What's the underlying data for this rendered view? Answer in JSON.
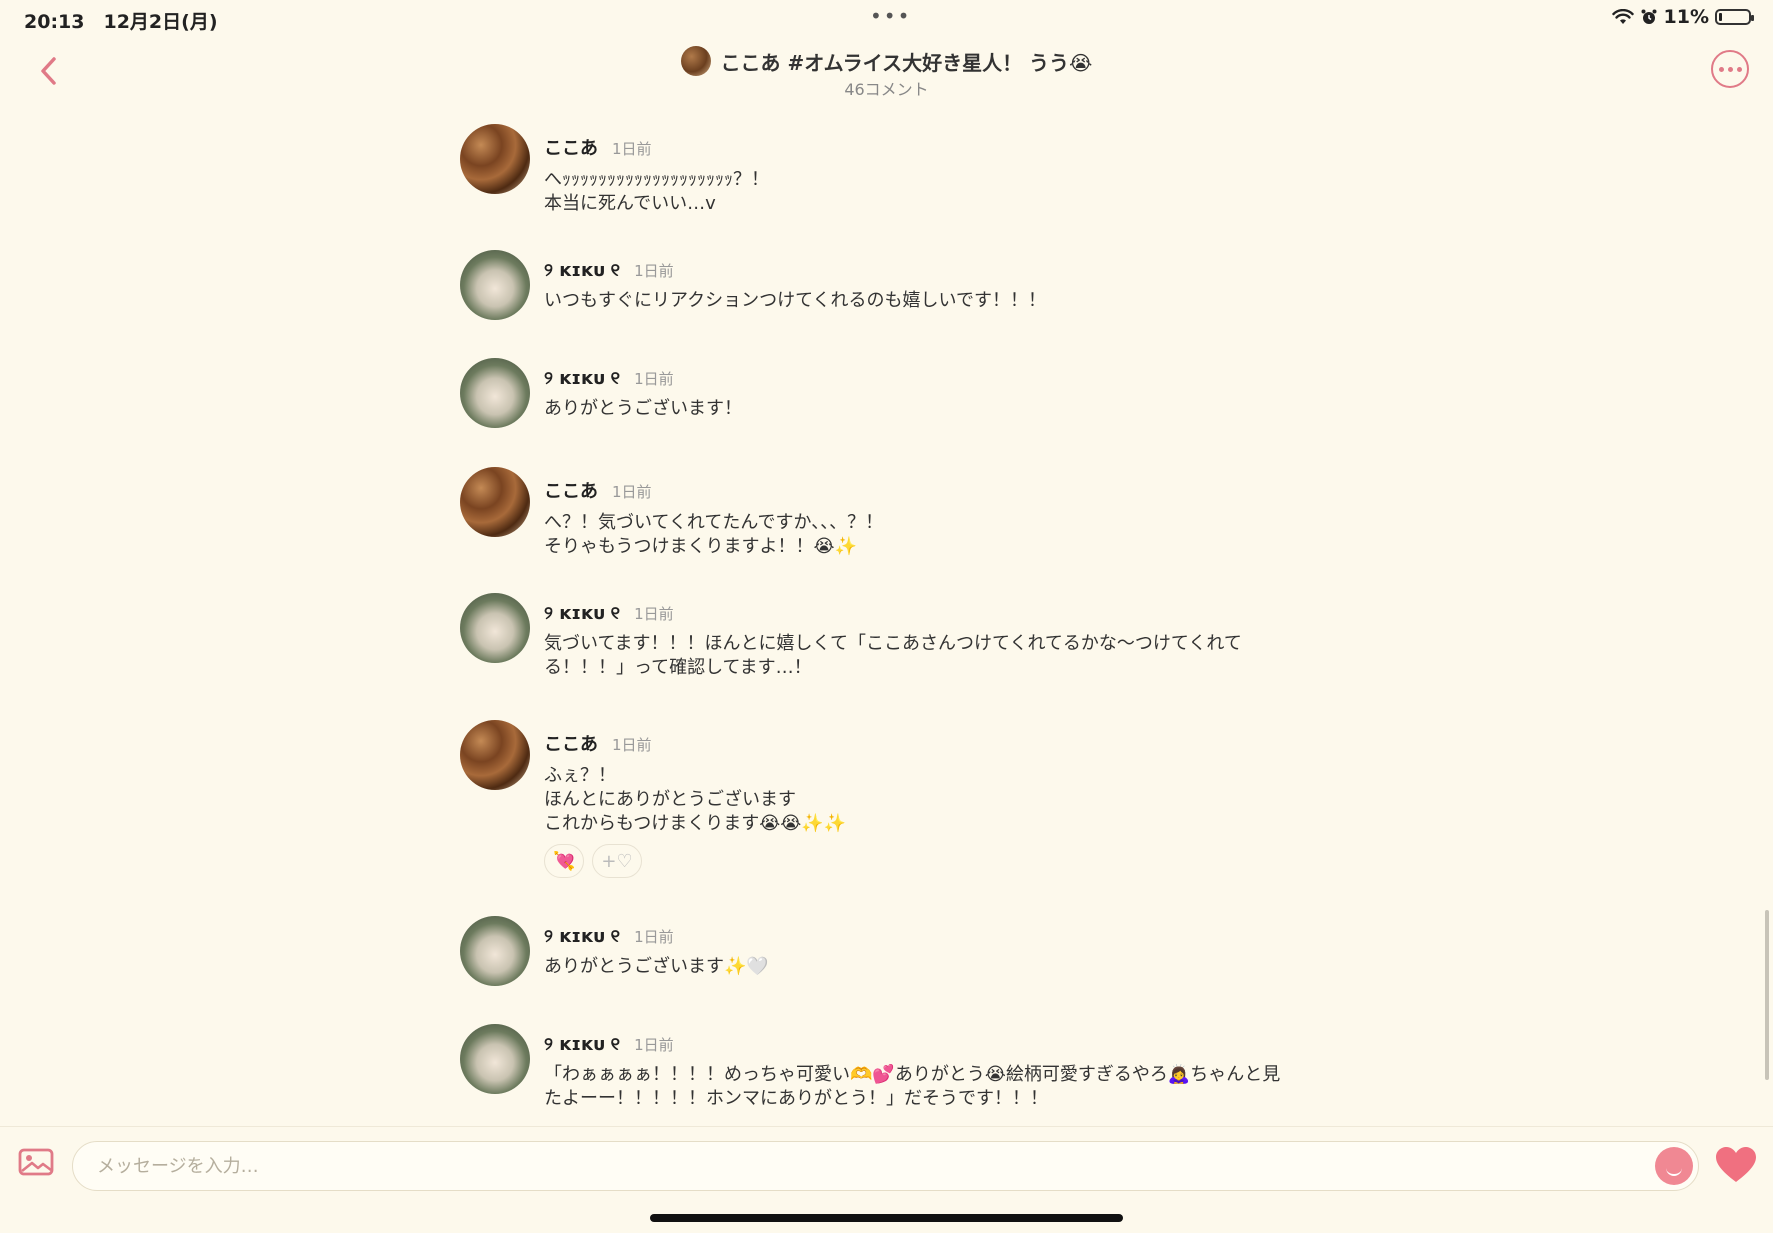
{
  "status_bar": {
    "time": "20:13　12月2日(月)",
    "dots": "•••",
    "battery_percent": "11%",
    "battery_level": 0.11
  },
  "header": {
    "title": "ここあ #オムライス大好き星人！ うう😭",
    "subtitle": "46コメント",
    "back_icon": "chevron-left-icon",
    "more_icon": "ellipsis-circle-icon"
  },
  "colors": {
    "background": "#fdf9ec",
    "accent": "#e07a87",
    "heart": "#f07080"
  },
  "messages": [
    {
      "user": "ここあ",
      "avatar": "koko",
      "time": "1日前",
      "text": "へｯｯｯｯｯｯｯｯｯｯｯｯｯｯｯｯｯｯｯ？！\n本当に死んでいい…v"
    },
    {
      "user": "୨ ᴋɪᴋᴜ ୧",
      "avatar": "kiku",
      "time": "1日前",
      "text": "いつもすぐにリアクションつけてくれるのも嬉しいです！！！"
    },
    {
      "user": "୨ ᴋɪᴋᴜ ୧",
      "avatar": "kiku",
      "time": "1日前",
      "text": "ありがとうございます！"
    },
    {
      "user": "ここあ",
      "avatar": "koko",
      "time": "1日前",
      "text": "へ？！気づいてくれてたんですか、、、？！\nそりゃもうつけまくりますよ！！😭✨"
    },
    {
      "user": "୨ ᴋɪᴋᴜ ୧",
      "avatar": "kiku",
      "time": "1日前",
      "text": "気づいてます！！！ほんとに嬉しくて「ここあさんつけてくれてるかな〜つけてくれて\nる！！！」って確認してます…！"
    },
    {
      "user": "ここあ",
      "avatar": "koko",
      "time": "1日前",
      "text": "ふぇ？！\nほんとにありがとうございます\nこれからもつけまくります😭😭✨✨",
      "reactions": [
        "💘",
        "+♡"
      ]
    },
    {
      "user": "୨ ᴋɪᴋᴜ ୧",
      "avatar": "kiku",
      "time": "1日前",
      "text": "ありがとうございます✨🤍"
    },
    {
      "user": "୨ ᴋɪᴋᴜ ୧",
      "avatar": "kiku",
      "time": "1日前",
      "text": "「わぁぁぁぁ！！！！めっちゃ可愛い🫶💕ありがとう😭絵柄可愛すぎるやろ🙇‍♀️ちゃんと見\nたよーー！！！！！ホンマにありがとう！」だそうです！！！"
    }
  ],
  "input": {
    "placeholder": "メッセージを入力…"
  }
}
